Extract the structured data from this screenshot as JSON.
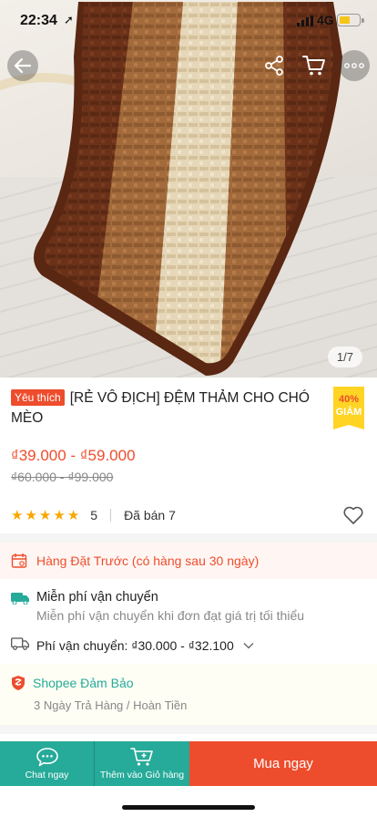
{
  "status_bar": {
    "time": "22:34",
    "network": "4G"
  },
  "gallery": {
    "counter": "1/7"
  },
  "icons": {
    "back": "arrow-left-icon",
    "share": "share-icon",
    "cart": "cart-icon",
    "more": "more-icon"
  },
  "product": {
    "badge": "Yêu thích",
    "title": "[RẺ VÔ ĐỊCH] ĐỆM THẢM CHO CHÓ MÈO",
    "discount_percent": "40%",
    "discount_label": "GIẢM",
    "price_range": "₫39.000 - ₫59.000",
    "original_price_range": "₫60.000 - ₫99.000",
    "rating": "5",
    "sold": "Đã bán 7"
  },
  "preorder": {
    "text": "Hàng Đặt Trước (có hàng sau 30 ngày)"
  },
  "shipping": {
    "free_title": "Miễn phí vận chuyển",
    "free_subtitle": "Miễn phí vận chuyển khi đơn đạt giá trị tối thiểu",
    "fee_text": "Phí vận chuyển: ₫30.000 - ₫32.100"
  },
  "guarantee": {
    "title": "Shopee Đảm Bảo",
    "subtitle": "3 Ngày Trả Hàng / Hoàn Tiền"
  },
  "bottom_bar": {
    "chat_label": "Chat ngay",
    "add_cart_label": "Thêm vào Giỏ hàng",
    "buy_label": "Mua ngay"
  },
  "colors": {
    "brand": "#ee4d2d",
    "teal": "#26aa99",
    "star": "#f6a700",
    "badge_yellow": "#ffd424"
  }
}
